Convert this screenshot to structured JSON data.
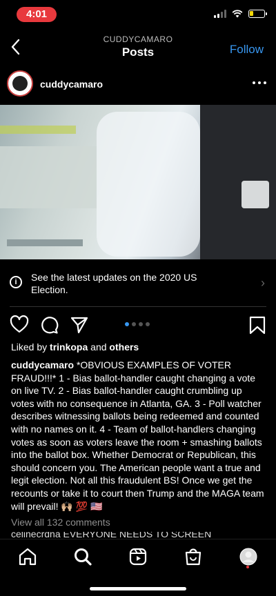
{
  "status_bar": {
    "time": "4:01"
  },
  "header": {
    "account": "CUDDYCAMARO",
    "title": "Posts",
    "follow_label": "Follow"
  },
  "post": {
    "username": "cuddycamaro",
    "banner_text": "See the latest updates on the 2020 US Election.",
    "liked_by_prefix": "Liked by",
    "liked_by_user": "trinkopa",
    "liked_by_and": "and",
    "liked_by_others": "others",
    "caption_user": "cuddycamaro",
    "caption_text": "*OBVIOUS EXAMPLES OF VOTER FRAUD!!!* 1 - Bias ballot-handler caught changing a vote on live TV. 2 - Bias ballot-handler caught crumbling up votes with no consequence in Atlanta, GA. 3 - Poll watcher describes witnessing ballots being redeemed and counted with no names on it. 4 - Team of ballot-handlers changing votes as soon as voters leave the room + smashing ballots into the ballot box. Whether Democrat or Republican, this should concern you. The American people want a true and legit election. Not all this fraudulent BS! Once we get the recounts or take it to court then Trump and the MAGA team will prevail! 🙌🏼 💯 🇺🇸",
    "view_comments": "View all 132 comments",
    "next_comment": "celinecrdna EVERYONE NEEDS TO SCREEN",
    "carousel_total": 4,
    "carousel_active": 1
  },
  "colors": {
    "accent": "#3897f0",
    "time_pill": "#e8393d",
    "battery": "#f5d90a",
    "muted": "#8e8e8e"
  },
  "icons": {
    "back": "chevron-left-icon",
    "more": "more-horizontal-icon",
    "info": "info-icon",
    "like": "heart-icon",
    "comment": "comment-icon",
    "share": "send-icon",
    "save": "bookmark-icon",
    "home": "home-icon",
    "search": "search-icon",
    "reels": "reels-icon",
    "shop": "shop-icon",
    "profile": "profile-icon"
  }
}
